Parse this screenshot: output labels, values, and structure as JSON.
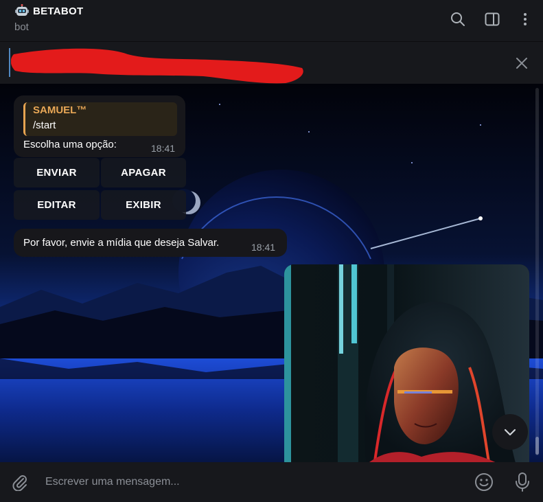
{
  "header": {
    "title": "BETABOT",
    "subtitle": "bot",
    "icons": [
      "robot-icon",
      "search-icon",
      "sidebar-toggle-icon",
      "more-vertical-icon"
    ]
  },
  "pinned": {
    "icons": [
      "close-icon"
    ]
  },
  "messages": [
    {
      "reply_name": "SAMUEL™",
      "reply_text": "/start",
      "text": "Escolha uma opção:",
      "time": "18:41"
    },
    {
      "text": "Por favor, envie a mídia que deseja Salvar.",
      "time": "18:41"
    }
  ],
  "keyboard": {
    "enviar": "ENVIAR",
    "apagar": "APAGAR",
    "editar": "EDITAR",
    "exibir": "EXIBIR"
  },
  "composer": {
    "placeholder": "Escrever uma mensagem...",
    "icons": [
      "paperclip-icon",
      "emoji-icon",
      "microphone-icon"
    ]
  },
  "colors": {
    "accent": "#5288c1",
    "reply_name": "#e8a756",
    "bubble": "#17171b",
    "header": "#17181c",
    "redaction": "#e31b1b"
  }
}
